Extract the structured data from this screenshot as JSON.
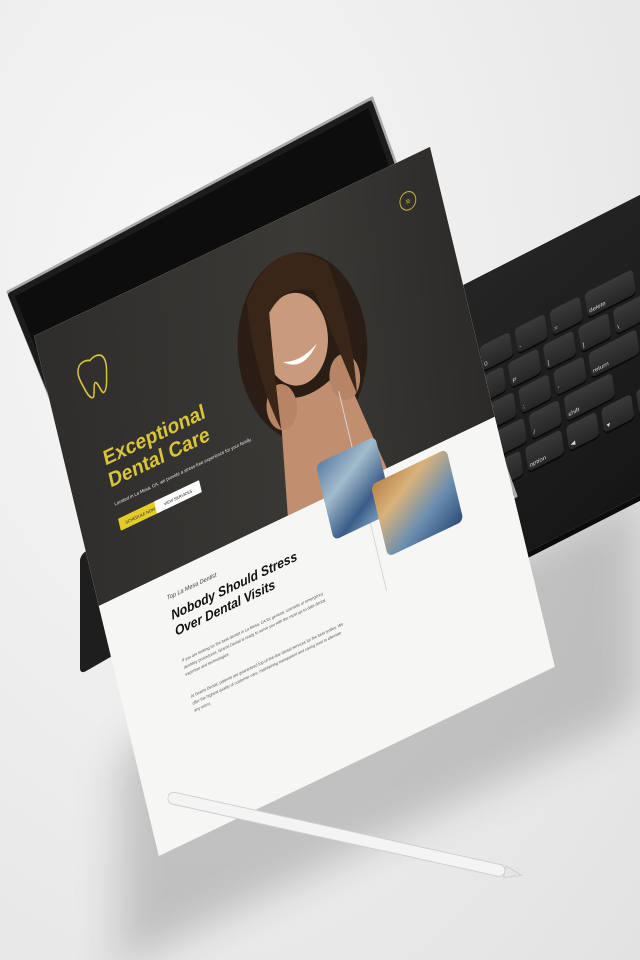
{
  "hero": {
    "title": "Exceptional Dental Care",
    "subtitle": "Located in La Mesa, CA, we provide a stress-free experience for your family.",
    "primary_button": "SCHEDULE NOW",
    "secondary_button": "VIEW SERVICES"
  },
  "intro": {
    "eyebrow": "Top La Mesa Dentist",
    "title": "Nobody Should Stress Over Dental Visits",
    "paragraph_1": "If you are looking for the best dentist in La Mesa, CA for general, cosmetic or emergency dentistry procedures, Grams Dental is ready to serve you with the most up-to-date dental expertise and technologies.",
    "paragraph_2": "At Grams Dental, patients are guaranteed top-of-the-line dental services for the best smiles. We offer the highest quality of customer care, maintaining transparent and caring trust to alleviate any worry."
  },
  "icons": {
    "menu": "hamburger-menu-icon",
    "logo": "tooth-logo-icon"
  },
  "keyboard": {
    "rows": [
      [
        "esc",
        "1",
        "2",
        "3",
        "4",
        "5",
        "6",
        "7",
        "8",
        "9",
        "0",
        "-",
        "=",
        "delete"
      ],
      [
        "tab",
        "Q",
        "W",
        "E",
        "R",
        "T",
        "Y",
        "U",
        "I",
        "O",
        "P",
        "[",
        "]",
        "\\"
      ],
      [
        "caps lock",
        "A",
        "S",
        "D",
        "F",
        "G",
        "H",
        "J",
        "K",
        "L",
        ";",
        "'",
        "return"
      ],
      [
        "shift",
        "Z",
        "X",
        "C",
        "V",
        "B",
        "N",
        "M",
        ",",
        ".",
        "/",
        "shift"
      ],
      [
        "fn",
        "control",
        "option",
        "cmd",
        "",
        "cmd",
        "option",
        "◀",
        "▼",
        "▶"
      ]
    ]
  },
  "colors": {
    "accent": "#d9c43a",
    "hero_bg": "#343230",
    "section_bg": "#f6f6f4"
  }
}
